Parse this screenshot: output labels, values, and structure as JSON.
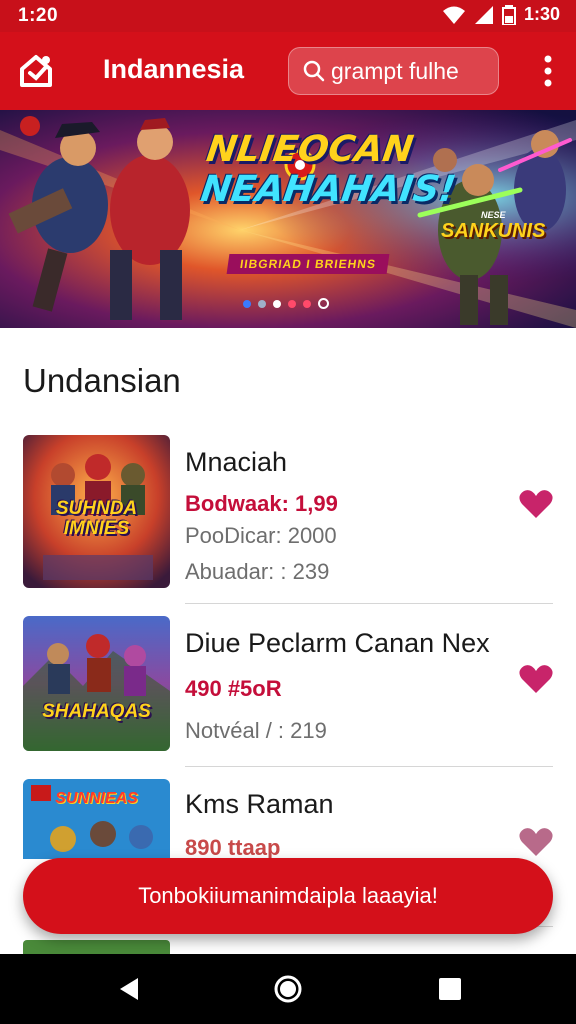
{
  "status_bar": {
    "time": "1:20",
    "clock_right": "1:30"
  },
  "app_bar": {
    "title": "Indannesia",
    "search_placeholder": "grampt fulhe",
    "brand_color": "#d4101a"
  },
  "banner": {
    "title_line1": "NLIEOCAN",
    "title_line2": "NEAHAHAIS!",
    "subtitle": "IIBGRIAD I BRIEHNS",
    "badge_top": "NESE",
    "badge": "SANKUNIS",
    "slide_count": 6,
    "active_slide": 5
  },
  "section": {
    "title": "Undansian"
  },
  "games": [
    {
      "thumb_label": "SUHNDA IMNIES",
      "name": "Mnaciah",
      "price": "Bodwaak: 1,99",
      "meta1": "PooDicar: 2000",
      "meta2": "Abuadar: : 239",
      "heart_color": "#c8246a"
    },
    {
      "thumb_label": "SHAHAQAS",
      "name": "Diue Peclarm Canan Nex",
      "price": "490 #5oR",
      "meta1": "Notvéal / : 219",
      "meta2": "",
      "heart_color": "#c8246a"
    },
    {
      "thumb_label": "SUNNIEAS",
      "name": "Kms Raman",
      "price": "890 ttaap",
      "meta1": "",
      "meta2": "",
      "heart_color": "#b86a8a"
    }
  ],
  "toast": {
    "message": "Tonbokiiumanimdaipla laaayia!"
  },
  "nav": {
    "back": "back-icon",
    "home": "home-icon",
    "recents": "recents-icon"
  }
}
